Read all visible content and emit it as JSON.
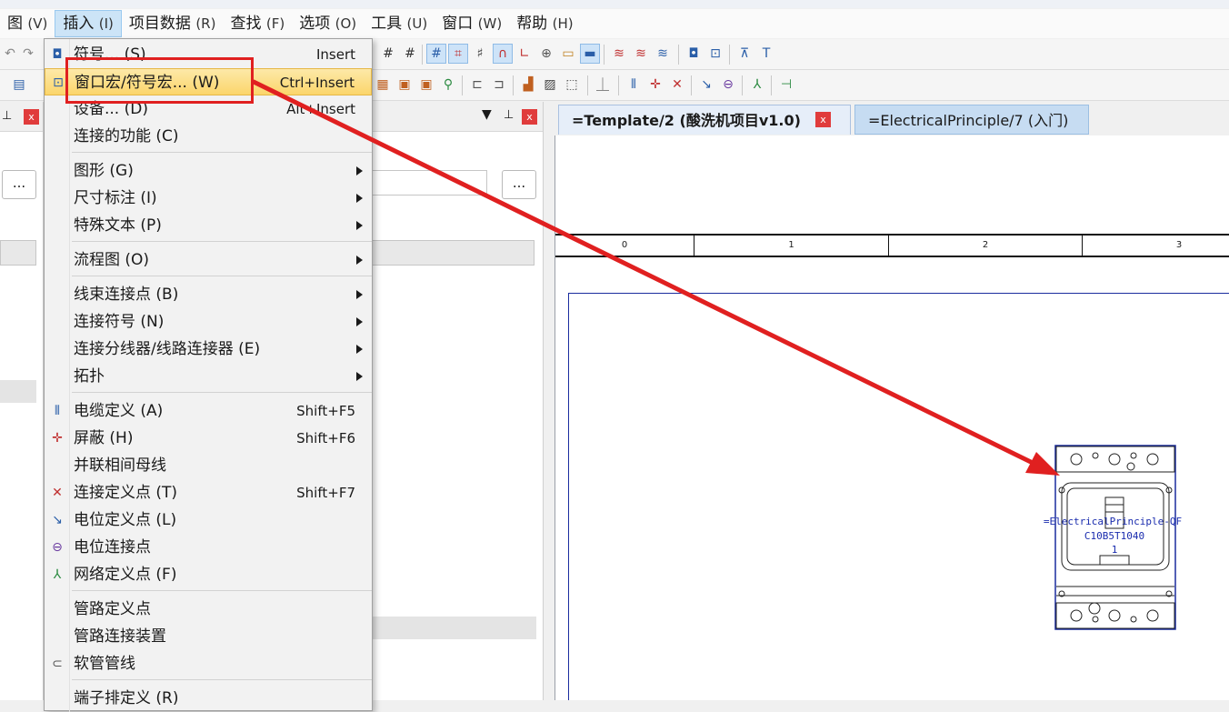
{
  "menubar": {
    "items": [
      {
        "label": "图",
        "key": "(V)"
      },
      {
        "label": "插入",
        "key": "(I)"
      },
      {
        "label": "项目数据",
        "key": "(R)"
      },
      {
        "label": "查找",
        "key": "(F)"
      },
      {
        "label": "选项",
        "key": "(O)"
      },
      {
        "label": "工具",
        "key": "(U)"
      },
      {
        "label": "窗口",
        "key": "(W)"
      },
      {
        "label": "帮助",
        "key": "(H)"
      }
    ]
  },
  "insert_menu": {
    "items": [
      {
        "label": "符号... (S)",
        "shortcut": "Insert"
      },
      {
        "label": "窗口宏/符号宏... (W)",
        "shortcut": "Ctrl+Insert"
      },
      {
        "label": "设备... (D)",
        "shortcut": "Alt+Insert"
      },
      {
        "label": "连接的功能 (C)",
        "shortcut": ""
      },
      {
        "label": "图形 (G)",
        "shortcut": ""
      },
      {
        "label": "尺寸标注 (I)",
        "shortcut": ""
      },
      {
        "label": "特殊文本 (P)",
        "shortcut": ""
      },
      {
        "label": "流程图 (O)",
        "shortcut": ""
      },
      {
        "label": "线束连接点 (B)",
        "shortcut": ""
      },
      {
        "label": "连接符号 (N)",
        "shortcut": ""
      },
      {
        "label": "连接分线器/线路连接器 (E)",
        "shortcut": ""
      },
      {
        "label": "拓扑",
        "shortcut": ""
      },
      {
        "label": "电缆定义 (A)",
        "shortcut": "Shift+F5"
      },
      {
        "label": "屏蔽 (H)",
        "shortcut": "Shift+F6"
      },
      {
        "label": "并联相间母线",
        "shortcut": ""
      },
      {
        "label": "连接定义点 (T)",
        "shortcut": "Shift+F7"
      },
      {
        "label": "电位定义点 (L)",
        "shortcut": ""
      },
      {
        "label": "电位连接点",
        "shortcut": ""
      },
      {
        "label": "网络定义点 (F)",
        "shortcut": ""
      },
      {
        "label": "管路定义点",
        "shortcut": ""
      },
      {
        "label": "管路连接装置",
        "shortcut": ""
      },
      {
        "label": "软管管线",
        "shortcut": ""
      },
      {
        "label": "端子排定义 (R)",
        "shortcut": ""
      }
    ]
  },
  "panels": {
    "dots_label": "...",
    "close_label": "x",
    "pin_label": "▾ ⊥"
  },
  "tabs": [
    {
      "label": "=Template/2 (酸洗机项目v1.0)"
    },
    {
      "label": "=ElectricalPrinciple/7 (入门)"
    }
  ],
  "ruler": {
    "columns": [
      "0",
      "1",
      "2",
      "3"
    ]
  },
  "breaker": {
    "label_line1": "=ElectricalPrinciple-QF",
    "label_line2": "C10B5T1040",
    "label_line3": "1"
  },
  "colors": {
    "accent": "#e02020",
    "highlight": "#fbd56b",
    "schematic_blue": "#1a2c9e"
  }
}
